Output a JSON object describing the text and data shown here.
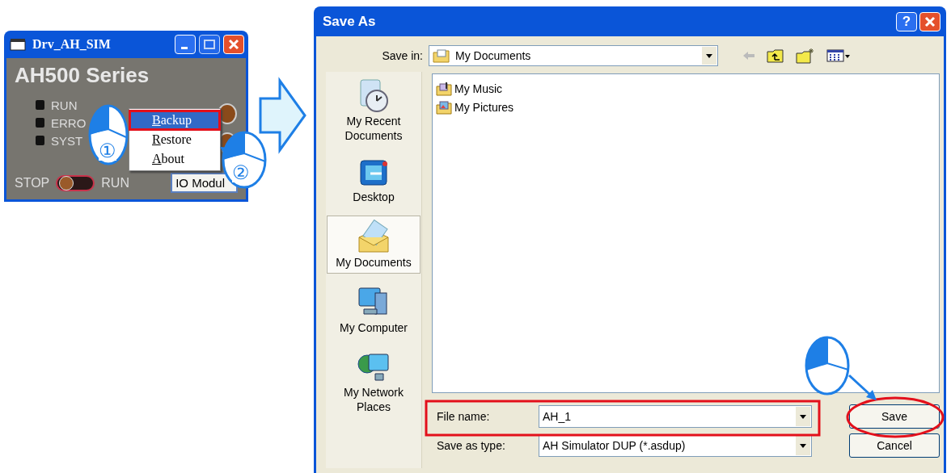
{
  "small_window": {
    "title": "Drv_AH_SIM",
    "heading": "AH500 Series",
    "leds": [
      {
        "label": "RUN"
      },
      {
        "label": "ERRO"
      },
      {
        "label": "SYST"
      }
    ],
    "switch": {
      "left_label": "STOP",
      "right_label": "RUN",
      "on": false
    },
    "io_button": "IO Modul"
  },
  "context_menu": {
    "items": [
      {
        "label": "Backup",
        "selected": true
      },
      {
        "label": "Restore",
        "selected": false
      },
      {
        "label": "About",
        "selected": false
      }
    ]
  },
  "step_marks": [
    "①",
    "②"
  ],
  "dialog": {
    "title": "Save As",
    "help_button": "?",
    "save_in": {
      "label": "Save in:",
      "value": "My Documents"
    },
    "places": [
      {
        "label": "My Recent Documents",
        "kind": "recent",
        "selected": false
      },
      {
        "label": "Desktop",
        "kind": "desktop",
        "selected": false
      },
      {
        "label": "My Documents",
        "kind": "documents",
        "selected": true
      },
      {
        "label": "My Computer",
        "kind": "computer",
        "selected": false
      },
      {
        "label": "My Network Places",
        "kind": "network",
        "selected": false
      }
    ],
    "files": [
      {
        "name": "My Music",
        "kind": "music"
      },
      {
        "name": "My Pictures",
        "kind": "pictures"
      }
    ],
    "file_name": {
      "label": "File name:",
      "value": "AH_1"
    },
    "save_as_type": {
      "label": "Save as type:",
      "value": "AH Simulator DUP (*.asdup)"
    },
    "buttons": [
      "Save",
      "Cancel"
    ]
  }
}
